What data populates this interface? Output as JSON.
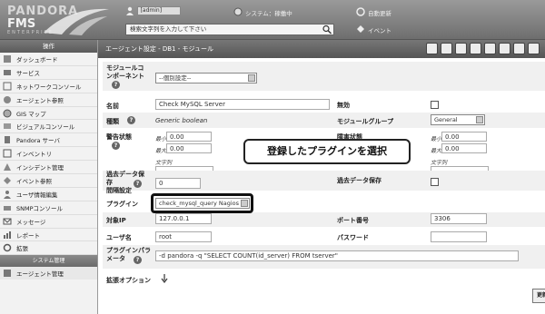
{
  "header": {
    "logo_top": "PANDORA",
    "logo_main": "FMS",
    "logo_sub": "ENTERPRISE",
    "user": "[admin]",
    "system_status": "システム：稼働中",
    "autorefresh": "自動更新",
    "events": "イベント",
    "search_placeholder": "検索文字列を入力して下さい"
  },
  "sidebar": {
    "operation_header": "操作",
    "items": [
      {
        "label": "ダッシュボード",
        "icon": "dashboard-icon"
      },
      {
        "label": "サービス",
        "icon": "services-icon"
      },
      {
        "label": "ネットワークコンソール",
        "icon": "network-console-icon"
      },
      {
        "label": "エージェント参照",
        "icon": "agent-view-icon"
      },
      {
        "label": "GIS マップ",
        "icon": "gis-map-icon"
      },
      {
        "label": "ビジュアルコンソール",
        "icon": "visual-console-icon"
      },
      {
        "label": "Pandora サーバ",
        "icon": "server-icon"
      },
      {
        "label": "インベントリ",
        "icon": "inventory-icon"
      },
      {
        "label": "インシデント管理",
        "icon": "incident-icon"
      },
      {
        "label": "イベント参照",
        "icon": "events-icon"
      },
      {
        "label": "ユーザ情報編集",
        "icon": "user-edit-icon"
      },
      {
        "label": "SNMPコンソール",
        "icon": "snmp-icon"
      },
      {
        "label": "メッセージ",
        "icon": "messages-icon"
      },
      {
        "label": "レポート",
        "icon": "reports-icon"
      },
      {
        "label": "拡張",
        "icon": "extensions-icon"
      }
    ],
    "system_header": "システム管理",
    "agent_mgmt": "エージェント管理"
  },
  "titlebar": {
    "title": "エージェント設定 - DB1 - モジュール"
  },
  "form": {
    "module_component_label": "モジュールコンポーネント",
    "module_component_value": "--個別設定--",
    "name_label": "名前",
    "name_value": "Check MySQL Server",
    "disabled_label": "無効",
    "type_label": "種類",
    "type_value": "Generic boolean",
    "module_group_label": "モジュールグループ",
    "module_group_value": "General",
    "warning_label": "警告状態",
    "critical_label": "障害状態",
    "min_label": "最小",
    "max_label": "最大",
    "warn_min": "0.00",
    "warn_max": "0.00",
    "crit_min": "0.00",
    "crit_max": "0.00",
    "string_label": "文字列",
    "historical_label": "過去データ保存",
    "interval_label": "間隔設定",
    "interval_value": "0",
    "plugin_label": "プラグイン",
    "plugin_value": "check_mysql_query Nagios",
    "target_ip_label": "対象IP",
    "target_ip_value": "127.0.0.1",
    "port_label": "ポート番号",
    "port_value": "3306",
    "username_label": "ユーザ名",
    "username_value": "root",
    "password_label": "パスワード",
    "plugin_params_label": "プラグインパラメータ",
    "plugin_params_value": "-d pandora -q \"SELECT COUNT(id_server) FROM tserver\"",
    "advanced_label": "拡張オプション",
    "update_button": "更新"
  },
  "callout": {
    "text": "登録したプラグインを選択"
  }
}
